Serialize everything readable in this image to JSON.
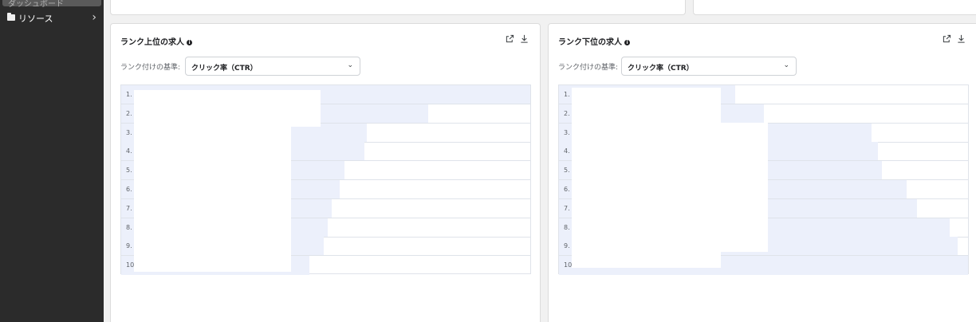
{
  "sidebar": {
    "prev_item_label": "ダッシュボード",
    "items": [
      {
        "label": "リソース",
        "icon": "folder-icon"
      }
    ]
  },
  "panels": [
    {
      "title": "ランク上位の求人",
      "rank_label": "ランク付けの基準:",
      "rank_value": "クリック率（CTR）",
      "rows": [
        {
          "num": "1.",
          "value": 1.0
        },
        {
          "num": "2.",
          "value": 0.75
        },
        {
          "num": "3.",
          "value": 0.6
        },
        {
          "num": "4.",
          "value": 0.595
        },
        {
          "num": "5.",
          "value": 0.545
        },
        {
          "num": "6.",
          "value": 0.535
        },
        {
          "num": "7.",
          "value": 0.515
        },
        {
          "num": "8.",
          "value": 0.505
        },
        {
          "num": "9.",
          "value": 0.495
        },
        {
          "num": "10.",
          "value": 0.46
        }
      ]
    },
    {
      "title": "ランク下位の求人",
      "rank_label": "ランク付けの基準:",
      "rank_value": "クリック率（CTR）",
      "rows": [
        {
          "num": "1.",
          "value": 0.43
        },
        {
          "num": "2.",
          "value": 0.5
        },
        {
          "num": "3.",
          "value": 0.765
        },
        {
          "num": "4.",
          "value": 0.78
        },
        {
          "num": "5.",
          "value": 0.79
        },
        {
          "num": "6.",
          "value": 0.85
        },
        {
          "num": "7.",
          "value": 0.875
        },
        {
          "num": "8.",
          "value": 0.955
        },
        {
          "num": "9.",
          "value": 0.975
        },
        {
          "num": "10.",
          "value": 1.0
        }
      ]
    }
  ]
}
